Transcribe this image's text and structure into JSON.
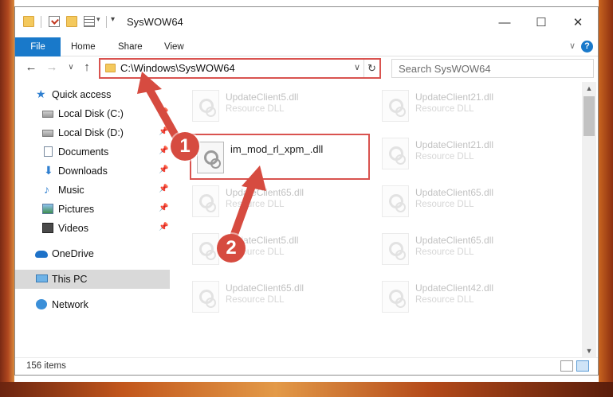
{
  "window": {
    "title": "SysWOW64",
    "controls": {
      "minimize": "—",
      "maximize": "☐",
      "close": "✕"
    }
  },
  "ribbon": {
    "tabs": [
      {
        "label": "File",
        "active": true
      },
      {
        "label": "Home"
      },
      {
        "label": "Share"
      },
      {
        "label": "View"
      }
    ],
    "help": "?",
    "expand": "∨"
  },
  "navigation": {
    "back": "←",
    "forward": "→",
    "recent": "∨",
    "up": "↑",
    "address": "C:\\Windows\\SysWOW64",
    "address_dropdown": "∨",
    "refresh": "↻",
    "search_placeholder": "Search SysWOW64"
  },
  "sidebar": {
    "items": [
      {
        "label": "Quick access",
        "icon": "star-icon"
      },
      {
        "label": "Local Disk (C:)",
        "icon": "drive-icon",
        "pinned": true
      },
      {
        "label": "Local Disk (D:)",
        "icon": "drive-icon",
        "pinned": true
      },
      {
        "label": "Documents",
        "icon": "documents-icon",
        "pinned": true
      },
      {
        "label": "Downloads",
        "icon": "downloads-icon",
        "pinned": true
      },
      {
        "label": "Music",
        "icon": "music-icon",
        "pinned": true
      },
      {
        "label": "Pictures",
        "icon": "pictures-icon",
        "pinned": true
      },
      {
        "label": "Videos",
        "icon": "videos-icon",
        "pinned": true
      },
      {
        "label": "OneDrive",
        "icon": "onedrive-icon"
      },
      {
        "label": "This PC",
        "icon": "this-pc-icon",
        "selected": true
      },
      {
        "label": "Network",
        "icon": "network-icon"
      }
    ],
    "pin_glyph": "📌"
  },
  "files": [
    {
      "name": "UpdateClient5.dll",
      "type": "Resource DLL"
    },
    {
      "name": "UpdateClient21.dll",
      "type": "Resource DLL"
    },
    {
      "name": "im_mod_rl_xpm_.dll",
      "type": ""
    },
    {
      "name": "UpdateClient21.dll",
      "type": "Resource DLL"
    },
    {
      "name": "UpdateClient65.dll",
      "type": "Resource DLL"
    },
    {
      "name": "UpdateClient65.dll",
      "type": "Resource DLL"
    },
    {
      "name": "UpdateClient5.dll",
      "type": "Resource DLL"
    },
    {
      "name": "UpdateClient65.dll",
      "type": "Resource DLL"
    },
    {
      "name": "UpdateClient65.dll",
      "type": "Resource DLL"
    },
    {
      "name": "UpdateClient42.dll",
      "type": "Resource DLL"
    }
  ],
  "status": {
    "item_count": "156 items"
  },
  "annotations": {
    "step1": "1",
    "step2": "2",
    "color": "#d64b40"
  }
}
